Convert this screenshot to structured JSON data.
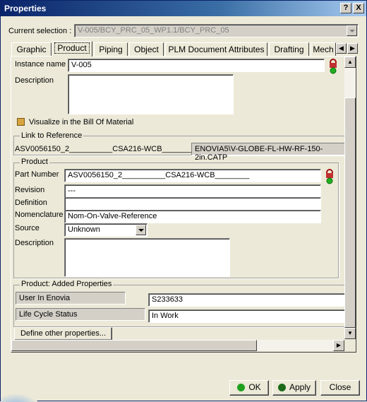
{
  "window": {
    "title": "Properties",
    "help_glyph": "?",
    "close_glyph": "X"
  },
  "current_selection": {
    "label": "Current selection :",
    "value": "V-005/BCY_PRC_05_WP1.1/BCY_PRC_05"
  },
  "tabs": [
    {
      "label": "Graphic"
    },
    {
      "label": "Product",
      "active": true
    },
    {
      "label": "Piping"
    },
    {
      "label": "Object"
    },
    {
      "label": "PLM Document Attributes"
    },
    {
      "label": "Drafting"
    },
    {
      "label": "Mech"
    }
  ],
  "instance": {
    "name_label": "Instance name",
    "name_value": "V-005",
    "description_label": "Description",
    "visualize_label": "Visualize in the Bill Of Material"
  },
  "link_to_reference": {
    "legend": "Link to Reference",
    "left_value": "ASV0056150_2__________CSA216-WCB________",
    "right_value": "ENOVIA5\\V-GLOBE-FL-HW-RF-150-2in.CATP"
  },
  "product": {
    "legend": "Product",
    "part_number_label": "Part Number",
    "part_number_value": "ASV0056150_2__________CSA216-WCB________",
    "revision_label": "Revision",
    "revision_value": "---",
    "definition_label": "Definition",
    "definition_value": "",
    "nomenclature_label": "Nomenclature",
    "nomenclature_value": "Nom-On-Valve-Reference",
    "source_label": "Source",
    "source_value": "Unknown",
    "description_label": "Description"
  },
  "added_properties": {
    "legend": "Product: Added Properties",
    "rows": [
      {
        "name": "User In Enovia",
        "value": "S233633"
      },
      {
        "name": "Life Cycle Status",
        "value": "In Work"
      }
    ]
  },
  "define_other_label": "Define other properties...",
  "buttons": {
    "ok": "OK",
    "apply": "Apply",
    "close": "Close"
  },
  "colors": {
    "title_start": "#0a246a",
    "title_end": "#a6caf0",
    "face": "#ece9d8",
    "ok_green": "#1fa01f"
  },
  "icons": {
    "lock": "padlock-status-icon",
    "scroll_up": "▲",
    "scroll_down": "▼",
    "scroll_left": "◀",
    "scroll_right": "▶"
  }
}
